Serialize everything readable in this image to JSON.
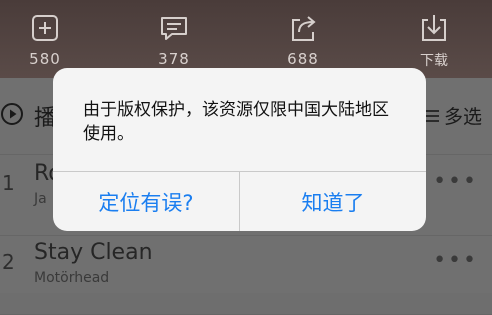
{
  "toolbar": {
    "collect": {
      "icon": "add-to-playlist-icon",
      "count": "580"
    },
    "comment": {
      "icon": "comment-icon",
      "count": "378"
    },
    "share": {
      "icon": "share-icon",
      "count": "688"
    },
    "download": {
      "icon": "download-icon",
      "label": "下载"
    }
  },
  "list": {
    "play_all_label": "播",
    "multi_select_label": "多选",
    "songs": [
      {
        "number": "1",
        "title": "Ro",
        "artist": "Ja"
      },
      {
        "number": "2",
        "title": "Stay Clean",
        "artist": "Motörhead"
      }
    ]
  },
  "dialog": {
    "message": "由于版权保护，该资源仅限中国大陆地区使用。",
    "left_button": "定位有误?",
    "right_button": "知道了"
  },
  "colors": {
    "accent": "#1a7ef0",
    "toolbar_bg": "#4f413f",
    "overlay": "#707070"
  }
}
